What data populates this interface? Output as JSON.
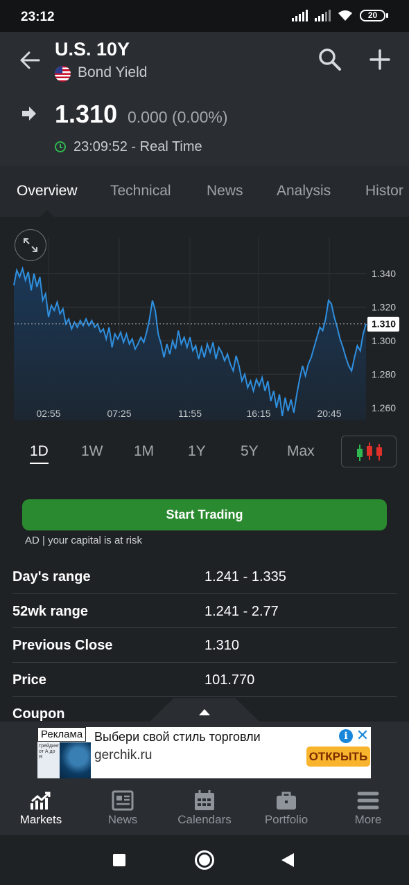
{
  "status_bar": {
    "time": "23:12",
    "battery": "20"
  },
  "header": {
    "title": "U.S. 10Y",
    "subtitle": "Bond Yield",
    "flag_icon": "us-flag-icon",
    "back_icon": "arrow-left-icon",
    "search_icon": "search-icon",
    "add_icon": "plus-icon"
  },
  "quote": {
    "price": "1.310",
    "change": "0.000 (0.00%)",
    "timestamp": "23:09:52 - Real Time",
    "direction_icon": "arrow-right-icon",
    "accent_color": "#2eb84f"
  },
  "tabs": [
    "Overview",
    "Technical",
    "News",
    "Analysis",
    "Histor"
  ],
  "active_tab": "Overview",
  "chart_data": {
    "type": "area",
    "x_ticks": [
      "02:55",
      "07:25",
      "11:55",
      "16:15",
      "20:45"
    ],
    "y_ticks": [
      "1.340",
      "1.320",
      "1.300",
      "1.280",
      "1.260"
    ],
    "ylim": [
      1.2525,
      1.3615
    ],
    "last_value_label": "1.310",
    "reference_line": 1.31,
    "grid": true,
    "line_color": "#2f8fdf",
    "values": [
      1.333,
      1.342,
      1.338,
      1.343,
      1.336,
      1.341,
      1.33,
      1.34,
      1.332,
      1.338,
      1.324,
      1.328,
      1.314,
      1.321,
      1.318,
      1.323,
      1.316,
      1.319,
      1.31,
      1.313,
      1.307,
      1.311,
      1.308,
      1.312,
      1.309,
      1.313,
      1.309,
      1.312,
      1.308,
      1.31,
      1.305,
      1.307,
      1.301,
      1.308,
      1.296,
      1.304,
      1.301,
      1.305,
      1.299,
      1.304,
      1.298,
      1.301,
      1.295,
      1.298,
      1.302,
      1.299,
      1.305,
      1.313,
      1.324,
      1.318,
      1.304,
      1.298,
      1.29,
      1.298,
      1.292,
      1.3,
      1.295,
      1.306,
      1.298,
      1.302,
      1.296,
      1.302,
      1.294,
      1.297,
      1.289,
      1.296,
      1.29,
      1.298,
      1.293,
      1.299,
      1.289,
      1.296,
      1.293,
      1.288,
      1.292,
      1.286,
      1.282,
      1.291,
      1.285,
      1.276,
      1.28,
      1.272,
      1.276,
      1.27,
      1.277,
      1.273,
      1.278,
      1.27,
      1.276,
      1.264,
      1.27,
      1.26,
      1.268,
      1.255,
      1.266,
      1.258,
      1.265,
      1.257,
      1.268,
      1.277,
      1.285,
      1.279,
      1.286,
      1.29,
      1.296,
      1.302,
      1.308,
      1.306,
      1.313,
      1.324,
      1.322,
      1.314,
      1.308,
      1.301,
      1.296,
      1.29,
      1.285,
      1.282,
      1.29,
      1.297,
      1.294,
      1.304,
      1.31
    ]
  },
  "time_ranges": [
    "1D",
    "1W",
    "1M",
    "1Y",
    "5Y",
    "Max"
  ],
  "active_range": "1D",
  "candle_button_icon": "candlestick-icon",
  "trade_button": "Start Trading",
  "ad_note": "AD | your capital is at risk",
  "stats": [
    {
      "label": "Day's range",
      "value": "1.241 - 1.335"
    },
    {
      "label": "52wk range",
      "value": "1.241 - 2.77"
    },
    {
      "label": "Previous Close",
      "value": "1.310"
    },
    {
      "label": "Price",
      "value": "101.770"
    },
    {
      "label": "Coupon",
      "value": ""
    }
  ],
  "ad": {
    "label": "Реклама",
    "thumb_caption": "трейдинг от А до Я",
    "headline": "Выбери свой стиль торговли",
    "domain": "gerchik.ru",
    "cta": "ОТКРЫТЬ",
    "cta_color": "#f8b42c"
  },
  "bottom_nav": [
    {
      "label": "Markets",
      "icon": "markets-chart-icon"
    },
    {
      "label": "News",
      "icon": "news-icon"
    },
    {
      "label": "Calendars",
      "icon": "calendar-icon"
    },
    {
      "label": "Portfolio",
      "icon": "briefcase-icon"
    },
    {
      "label": "More",
      "icon": "menu-icon"
    }
  ],
  "active_nav": "Markets"
}
